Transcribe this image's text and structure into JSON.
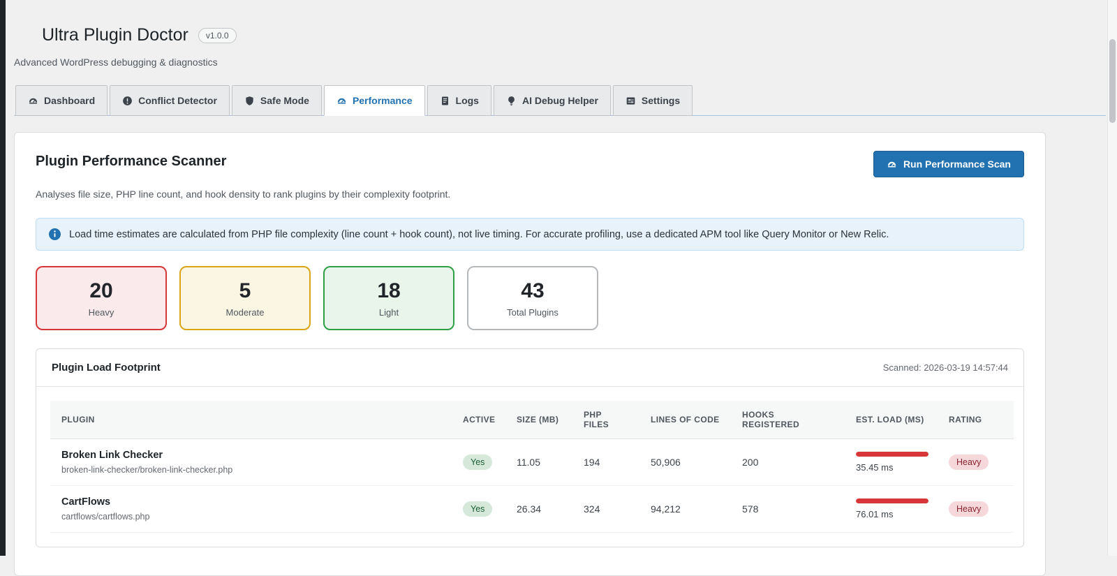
{
  "app": {
    "title": "Ultra Plugin Doctor",
    "version_badge": "v1.0.0",
    "subtitle": "Advanced WordPress debugging & diagnostics"
  },
  "tabs": [
    {
      "label": "Dashboard",
      "icon": "gauge-icon",
      "active": false
    },
    {
      "label": "Conflict Detector",
      "icon": "alert-circle-icon",
      "active": false
    },
    {
      "label": "Safe Mode",
      "icon": "shield-icon",
      "active": false
    },
    {
      "label": "Performance",
      "icon": "gauge-icon",
      "active": true
    },
    {
      "label": "Logs",
      "icon": "document-lines-icon",
      "active": false
    },
    {
      "label": "AI Debug Helper",
      "icon": "lightbulb-icon",
      "active": false
    },
    {
      "label": "Settings",
      "icon": "settings-panel-icon",
      "active": false
    }
  ],
  "scanner": {
    "title": "Plugin Performance Scanner",
    "run_button": "Run Performance Scan",
    "description": "Analyses file size, PHP line count, and hook density to rank plugins by their complexity footprint.",
    "info_notice": "Load time estimates are calculated from PHP file complexity (line count + hook count), not live timing. For accurate profiling, use a dedicated APM tool like Query Monitor or New Relic."
  },
  "stats": [
    {
      "value": "20",
      "label": "Heavy",
      "tone": "danger"
    },
    {
      "value": "5",
      "label": "Moderate",
      "tone": "warning"
    },
    {
      "value": "18",
      "label": "Light",
      "tone": "success"
    },
    {
      "value": "43",
      "label": "Total Plugins",
      "tone": "neutral"
    }
  ],
  "footprint": {
    "title": "Plugin Load Footprint",
    "scanned": "Scanned: 2026-03-19 14:57:44",
    "columns": [
      "Plugin",
      "Active",
      "Size (MB)",
      "PHP Files",
      "Lines of Code",
      "Hooks Registered",
      "Est. Load (ms)",
      "Rating"
    ],
    "rows": [
      {
        "name": "Broken Link Checker",
        "slug": "broken-link-checker/broken-link-checker.php",
        "active": "Yes",
        "size_mb": "11.05",
        "php_files": "194",
        "lines_of_code": "50,906",
        "hooks": "200",
        "est_load": "35.45 ms",
        "bar_percent": 100,
        "rating": "Heavy"
      },
      {
        "name": "CartFlows",
        "slug": "cartflows/cartflows.php",
        "active": "Yes",
        "size_mb": "26.34",
        "php_files": "324",
        "lines_of_code": "94,212",
        "hooks": "578",
        "est_load": "76.01 ms",
        "bar_percent": 100,
        "rating": "Heavy"
      }
    ]
  },
  "colors": {
    "accent": "#2271b1",
    "heavy": "#d63638",
    "moderate": "#d9a514",
    "light": "#2f9e44",
    "page_bg": "#f0f0f1"
  }
}
